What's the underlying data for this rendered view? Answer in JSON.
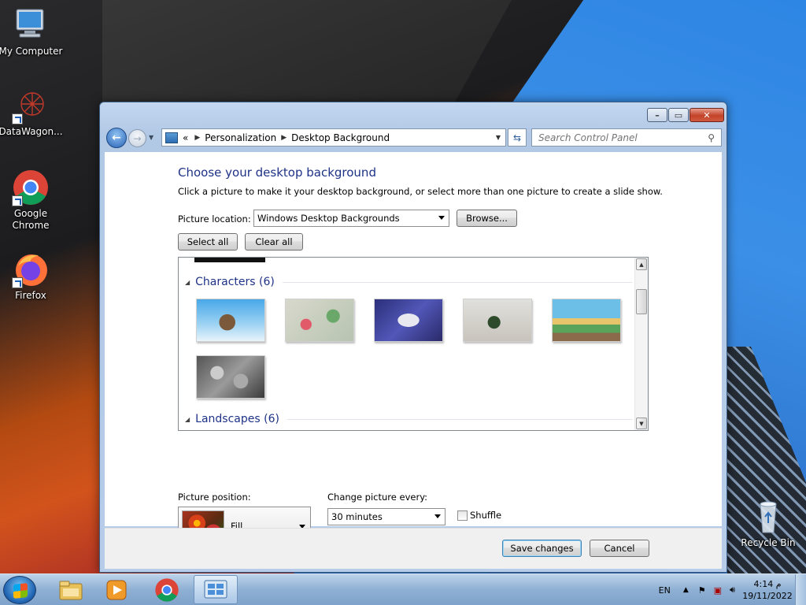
{
  "desktop": {
    "icons": [
      {
        "label": "My Computer",
        "icon": "computer-icon"
      },
      {
        "label": "DataWagon...",
        "icon": "datawagon-icon"
      },
      {
        "label": "Google Chrome",
        "icon": "chrome-icon"
      },
      {
        "label": "Firefox",
        "icon": "firefox-icon"
      },
      {
        "label": "Recycle Bin",
        "icon": "recycle-bin-icon"
      }
    ]
  },
  "window": {
    "caption_buttons": {
      "minimize": "minimize-icon",
      "maximize": "maximize-icon",
      "close": "close-icon"
    },
    "breadcrumb": [
      "Personalization",
      "Desktop Background"
    ],
    "breadcrumb_overflow": "«",
    "search_placeholder": "Search Control Panel",
    "heading": "Choose your desktop background",
    "description": "Click a picture to make it your desktop background, or select more than one picture to create a slide show.",
    "picture_location_label": "Picture location:",
    "picture_location_value": "Windows Desktop Backgrounds",
    "browse_label": "Browse...",
    "select_all_label": "Select all",
    "clear_all_label": "Clear all",
    "groups": [
      {
        "title": "Characters (6)",
        "thumbnails": [
          "Characters 1",
          "Characters 2",
          "Characters 3",
          "Characters 4",
          "Characters 5",
          "Characters 6"
        ]
      },
      {
        "title": "Landscapes (6)"
      }
    ],
    "picture_position_label": "Picture position:",
    "picture_position_value": "Fill",
    "change_every_label": "Change picture every:",
    "change_every_value": "30 minutes",
    "shuffle_label": "Shuffle",
    "shuffle_checked": false,
    "save_label": "Save changes",
    "cancel_label": "Cancel"
  },
  "taskbar": {
    "items": [
      "start-orb",
      "file-explorer-icon",
      "media-player-icon",
      "chrome-icon",
      "control-panel-icon"
    ],
    "language": "EN",
    "time": "4:14 م",
    "date": "19/11/2022"
  },
  "colors": {
    "heading": "#1e3287",
    "window_frame": "#b6cce8",
    "taskbar": "#8fb0d4"
  }
}
